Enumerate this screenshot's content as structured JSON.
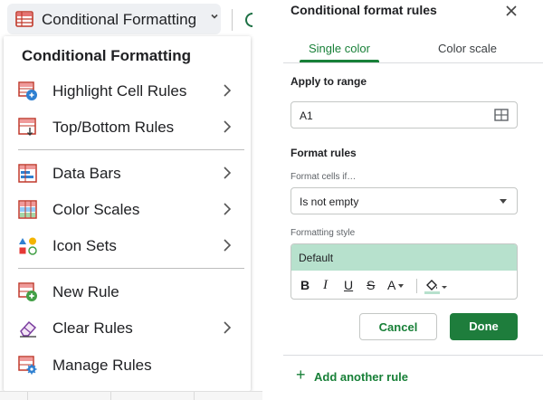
{
  "toolbar": {
    "button_label": "Conditional Formatting",
    "button_icon": "conditional-formatting-icon",
    "chevron_icon": "chevron-down-icon"
  },
  "menu": {
    "title": "Conditional Formatting",
    "items": [
      {
        "label": "Highlight Cell Rules",
        "icon": "highlight-cell-rules-icon",
        "has_submenu": true
      },
      {
        "label": "Top/Bottom Rules",
        "icon": "top-bottom-rules-icon",
        "has_submenu": true
      },
      {
        "label": "Data Bars",
        "icon": "data-bars-icon",
        "has_submenu": true
      },
      {
        "label": "Color Scales",
        "icon": "color-scales-icon",
        "has_submenu": true
      },
      {
        "label": "Icon Sets",
        "icon": "icon-sets-icon",
        "has_submenu": true
      },
      {
        "label": "New Rule",
        "icon": "new-rule-icon",
        "has_submenu": false
      },
      {
        "label": "Clear Rules",
        "icon": "clear-rules-icon",
        "has_submenu": true
      },
      {
        "label": "Manage Rules",
        "icon": "manage-rules-icon",
        "has_submenu": false
      }
    ]
  },
  "panel": {
    "title": "Conditional format rules",
    "close_icon": "close-icon",
    "tabs": [
      {
        "label": "Single color",
        "active": true
      },
      {
        "label": "Color scale",
        "active": false
      }
    ],
    "apply_to_range_label": "Apply to range",
    "range_value": "A1",
    "range_icon": "grid-select-icon",
    "format_rules_label": "Format rules",
    "format_cells_if_label": "Format cells if…",
    "condition_value": "Is not empty",
    "formatting_style_label": "Formatting style",
    "style_preset": "Default",
    "style_preview_color": "#b7e1cd",
    "toolbar": {
      "bold": "B",
      "italic": "I",
      "underline": "U",
      "strikethrough": "S",
      "text_color": "A",
      "fill_icon": "fill-color-icon"
    },
    "cancel_label": "Cancel",
    "done_label": "Done",
    "add_rule_label": "Add another rule",
    "add_rule_icon": "plus-icon",
    "accent_color": "#188038",
    "primary_button_color": "#1e7d3c"
  }
}
